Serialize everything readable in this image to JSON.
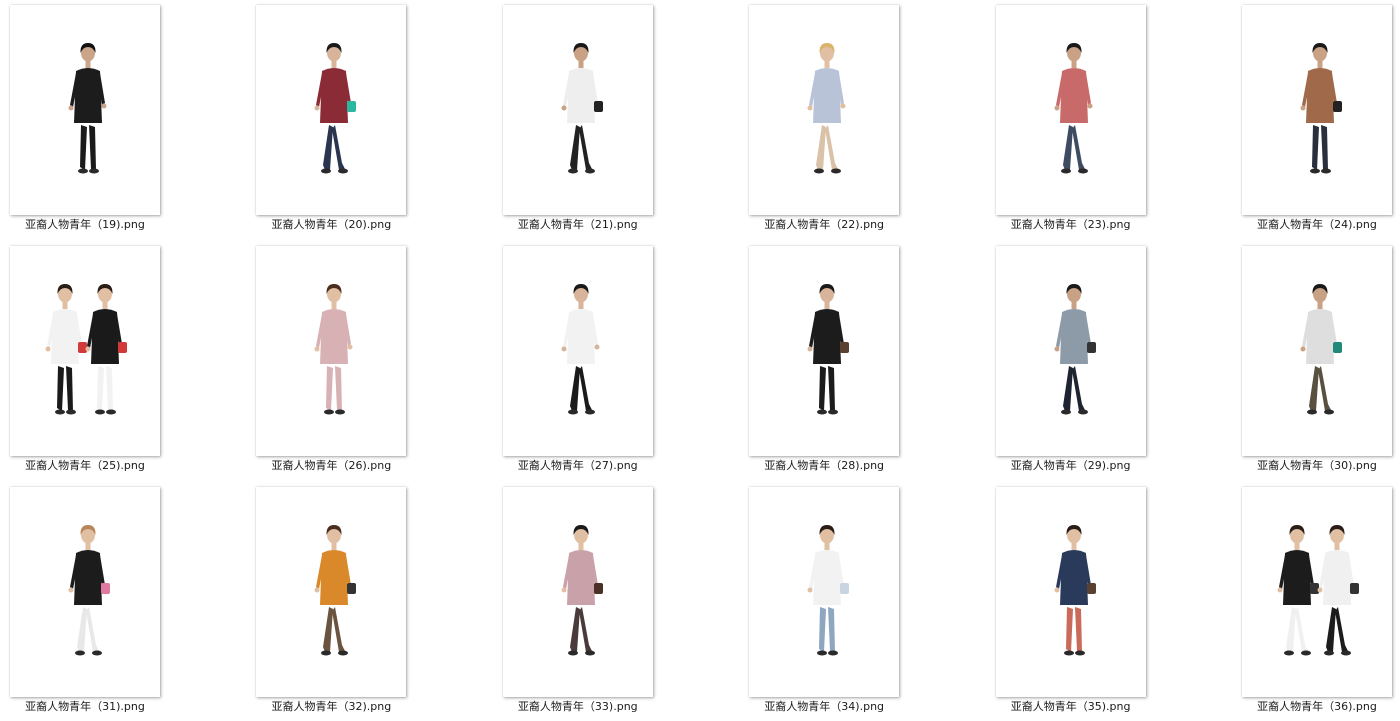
{
  "files": [
    {
      "name": "亚裔人物青年（19).png",
      "figure": {
        "top": "#1c1c1c",
        "bottom": "#1a1a1a",
        "skin": "#caa58a",
        "hair": "#111111",
        "count": 1,
        "pose": "stand"
      }
    },
    {
      "name": "亚裔人物青年（20).png",
      "figure": {
        "top": "#8a2b35",
        "bottom": "#2a3550",
        "skin": "#d8b59a",
        "hair": "#1a1a1a",
        "count": 1,
        "pose": "walk",
        "bag": "#2bb8a0"
      }
    },
    {
      "name": "亚裔人物青年（21).png",
      "figure": {
        "top": "#eeeeee",
        "bottom": "#222222",
        "skin": "#c9a184",
        "hair": "#1a1a1a",
        "count": 1,
        "pose": "walk",
        "bag": "#222222"
      }
    },
    {
      "name": "亚裔人物青年（22).png",
      "figure": {
        "top": "#b9c3d8",
        "bottom": "#d9c2a8",
        "skin": "#e0bfa3",
        "hair": "#d9b46a",
        "count": 1,
        "pose": "walk"
      }
    },
    {
      "name": "亚裔人物青年（23).png",
      "figure": {
        "top": "#c96a6a",
        "bottom": "#3d4c63",
        "skin": "#c9a184",
        "hair": "#1a1a1a",
        "count": 1,
        "pose": "walk"
      }
    },
    {
      "name": "亚裔人物青年（24).png",
      "figure": {
        "top": "#a06a4a",
        "bottom": "#2a2f3d",
        "skin": "#c9a184",
        "hair": "#1a1a1a",
        "count": 1,
        "pose": "stand",
        "bag": "#222222"
      }
    },
    {
      "name": "亚裔人物青年（25).png",
      "figure": {
        "top": "#f2f2f2",
        "bottom": "#1a1a1a",
        "skin": "#e0bfa3",
        "hair": "#2a1d17",
        "count": 2,
        "pose": "stand",
        "bag": "#d23a3a"
      }
    },
    {
      "name": "亚裔人物青年（26).png",
      "figure": {
        "top": "#d7b1b4",
        "bottom": "#d7b1b4",
        "skin": "#e0bfa3",
        "hair": "#4a2f20",
        "count": 1,
        "pose": "stand"
      }
    },
    {
      "name": "亚裔人物青年（27).png",
      "figure": {
        "top": "#f2f2f2",
        "bottom": "#1a1a1a",
        "skin": "#d8b59a",
        "hair": "#1a1a1a",
        "count": 1,
        "pose": "walk"
      }
    },
    {
      "name": "亚裔人物青年（28).png",
      "figure": {
        "top": "#1c1c1c",
        "bottom": "#1c1c1c",
        "skin": "#d8b59a",
        "hair": "#1a1a1a",
        "count": 1,
        "pose": "stand",
        "bag": "#5a4030"
      }
    },
    {
      "name": "亚裔人物青年（29).png",
      "figure": {
        "top": "#8d9aa8",
        "bottom": "#1f2530",
        "skin": "#c9a184",
        "hair": "#1a1a1a",
        "count": 1,
        "pose": "walk",
        "bag": "#333333"
      }
    },
    {
      "name": "亚裔人物青年（30).png",
      "figure": {
        "top": "#dedede",
        "bottom": "#5a5040",
        "skin": "#c9a184",
        "hair": "#1a1a1a",
        "count": 1,
        "pose": "walk",
        "bag": "#1f8a7a"
      }
    },
    {
      "name": "亚裔人物青年（31).png",
      "figure": {
        "top": "#1c1c1c",
        "bottom": "#e8e8e8",
        "skin": "#e0bfa3",
        "hair": "#b8865a",
        "count": 1,
        "pose": "walk",
        "bag": "#e07aa0"
      }
    },
    {
      "name": "亚裔人物青年（32).png",
      "figure": {
        "top": "#d9882a",
        "bottom": "#6a5440",
        "skin": "#e0bfa3",
        "hair": "#4a2f20",
        "count": 1,
        "pose": "walk",
        "bag": "#333333"
      }
    },
    {
      "name": "亚裔人物青年（33).png",
      "figure": {
        "top": "#c9a1a8",
        "bottom": "#4a3a3a",
        "skin": "#e0bfa3",
        "hair": "#1a1a1a",
        "count": 1,
        "pose": "walk",
        "bag": "#4a3025"
      }
    },
    {
      "name": "亚裔人物青年（34).png",
      "figure": {
        "top": "#f2f2f2",
        "bottom": "#8fa6c0",
        "skin": "#e0bfa3",
        "hair": "#2a1d17",
        "count": 1,
        "pose": "stand",
        "bag": "#c8d4e0"
      }
    },
    {
      "name": "亚裔人物青年（35).png",
      "figure": {
        "top": "#2a3a5a",
        "bottom": "#c96a5a",
        "skin": "#e0bfa3",
        "hair": "#2a1d17",
        "count": 1,
        "pose": "stand",
        "bag": "#5a4030"
      }
    },
    {
      "name": "亚裔人物青年（36).png",
      "figure": {
        "top": "#1c1c1c",
        "bottom": "#f0f0f0",
        "skin": "#e0bfa3",
        "hair": "#2a1d17",
        "count": 2,
        "pose": "walk",
        "bag": "#333333"
      }
    }
  ]
}
